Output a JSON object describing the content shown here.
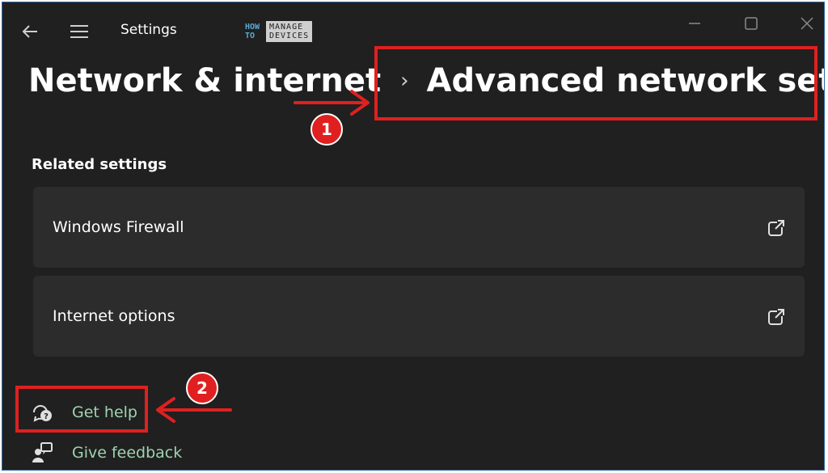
{
  "titlebar": {
    "app_title": "Settings",
    "logo_how": "HOW",
    "logo_to": "TO",
    "logo_manage": "MANAGE",
    "logo_devices": "DEVICES"
  },
  "breadcrumb": {
    "parent": "Network & internet",
    "separator": "›",
    "current": "Advanced network settings"
  },
  "annotations": {
    "badge1": "1",
    "badge2": "2",
    "highlight_color": "#e02020"
  },
  "related": {
    "title": "Related settings",
    "items": [
      {
        "label": "Windows Firewall",
        "icon": "open-external-icon"
      },
      {
        "label": "Internet options",
        "icon": "open-external-icon"
      }
    ]
  },
  "footer_links": [
    {
      "label": "Get help",
      "icon": "help-chat-icon"
    },
    {
      "label": "Give feedback",
      "icon": "feedback-icon"
    }
  ],
  "colors": {
    "background": "#202020",
    "card": "#2c2c2c",
    "link": "#9fd3b0",
    "accent_red": "#e02020"
  }
}
